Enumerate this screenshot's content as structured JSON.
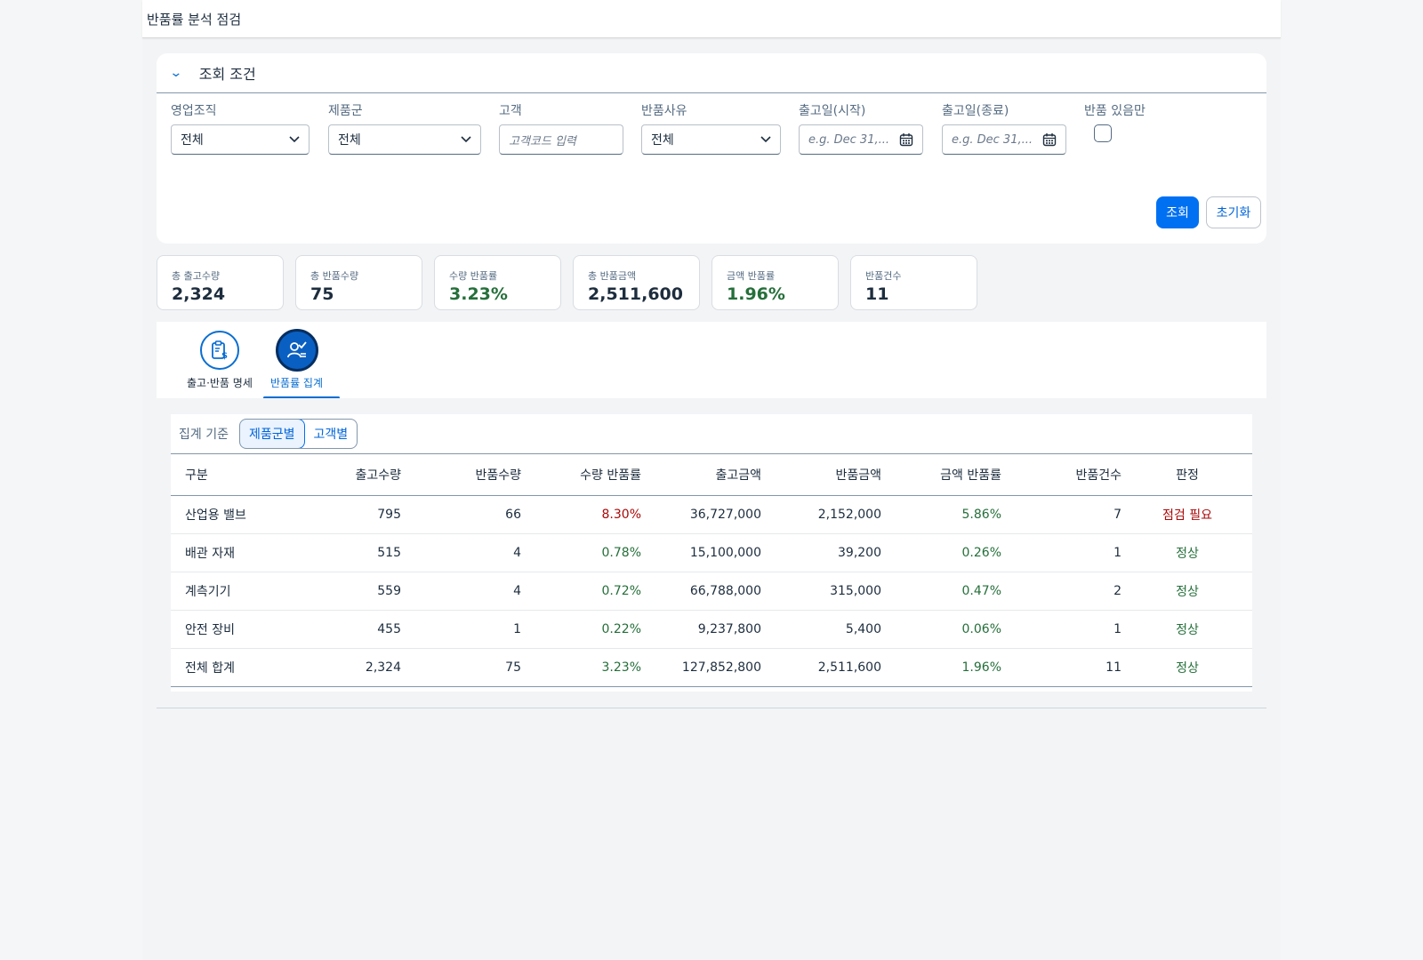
{
  "header": {
    "title": "반품률 분석 점검"
  },
  "filter": {
    "section_title": "조회 조건",
    "fields": {
      "org": {
        "label": "영업조직",
        "value": "전체"
      },
      "product_group": {
        "label": "제품군",
        "value": "전체"
      },
      "customer": {
        "label": "고객",
        "placeholder": "고객코드 입력"
      },
      "reason": {
        "label": "반품사유",
        "value": "전체"
      },
      "date_from": {
        "label": "출고일(시작)",
        "placeholder": "e.g. Dec 31,..."
      },
      "date_to": {
        "label": "출고일(종료)",
        "placeholder": "e.g. Dec 31,..."
      },
      "returns_only": {
        "label": "반품 있음만",
        "checked": false
      }
    },
    "search_button": "조회",
    "reset_button": "초기화"
  },
  "kpis": [
    {
      "label": "총 출고수량",
      "value": "2,324"
    },
    {
      "label": "총 반품수량",
      "value": "75"
    },
    {
      "label": "수량 반품률",
      "value": "3.23%"
    },
    {
      "label": "총 반품금액",
      "value": "2,511,600"
    },
    {
      "label": "금액 반품률",
      "value": "1.96%"
    },
    {
      "label": "반품건수",
      "value": "11"
    }
  ],
  "tabs": [
    {
      "label": "출고·반품 명세",
      "icon": "clipboard-money-icon"
    },
    {
      "label": "반품률 집계",
      "icon": "user-check-icon",
      "selected": true
    }
  ],
  "aggregation": {
    "label": "집계 기준",
    "options": [
      "제품군별",
      "고객별"
    ],
    "selected": "제품군별"
  },
  "table": {
    "columns": [
      "구분",
      "출고수량",
      "반품수량",
      "수량 반품률",
      "출고금액",
      "반품금액",
      "금액 반품률",
      "반품건수",
      "판정"
    ],
    "rows": [
      [
        "산업용 밸브",
        "795",
        "66",
        "8.30%",
        "36,727,000",
        "2,152,000",
        "5.86%",
        "7",
        "점검 필요"
      ],
      [
        "배관 자재",
        "515",
        "4",
        "0.78%",
        "15,100,000",
        "39,200",
        "0.26%",
        "1",
        "정상"
      ],
      [
        "계측기기",
        "559",
        "4",
        "0.72%",
        "66,788,000",
        "315,000",
        "0.47%",
        "2",
        "정상"
      ],
      [
        "안전 장비",
        "455",
        "1",
        "0.22%",
        "9,237,800",
        "5,400",
        "0.06%",
        "1",
        "정상"
      ],
      [
        "전체 합계",
        "2,324",
        "75",
        "3.23%",
        "127,852,800",
        "2,511,600",
        "1.96%",
        "11",
        "정상"
      ]
    ]
  },
  "colors": {
    "accent": "#0070f2",
    "alert": "#aa0808",
    "positive": "#256f3a"
  }
}
